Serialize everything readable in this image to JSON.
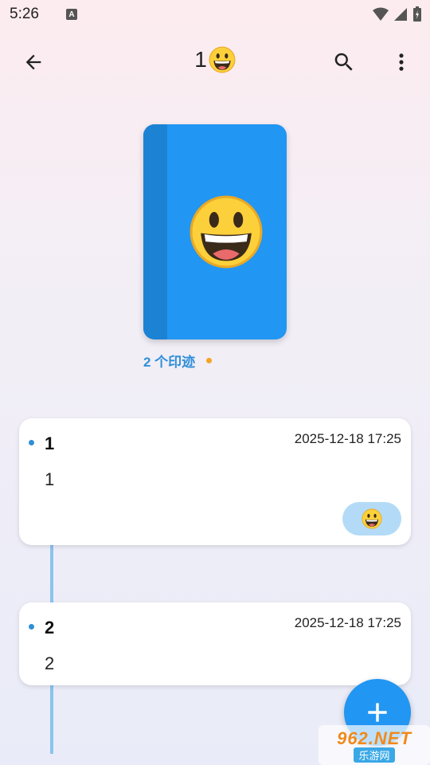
{
  "status_bar": {
    "time": "5:26",
    "badge": "A"
  },
  "app_bar": {
    "title_text": "1",
    "title_emoji": "grinning-face"
  },
  "book": {
    "cover_emoji": "grinning-face",
    "color": "#2196f3",
    "spine_color": "#1c82d4"
  },
  "footprints": {
    "count_label": "2 个印迹"
  },
  "entries": [
    {
      "title": "1",
      "timestamp": "2025-12-18 17:25",
      "body": "1",
      "reaction": "grinning-face"
    },
    {
      "title": "2",
      "timestamp": "2025-12-18 17:25",
      "body": "2"
    }
  ],
  "fab": {
    "icon": "plus-icon"
  },
  "watermark": {
    "top": "962.NET",
    "bottom": "乐游网"
  },
  "colors": {
    "accent": "#2196f3",
    "accent_text": "#2f8fd8",
    "orange_dot": "#f5a524",
    "chip": "#b3dbf7"
  }
}
